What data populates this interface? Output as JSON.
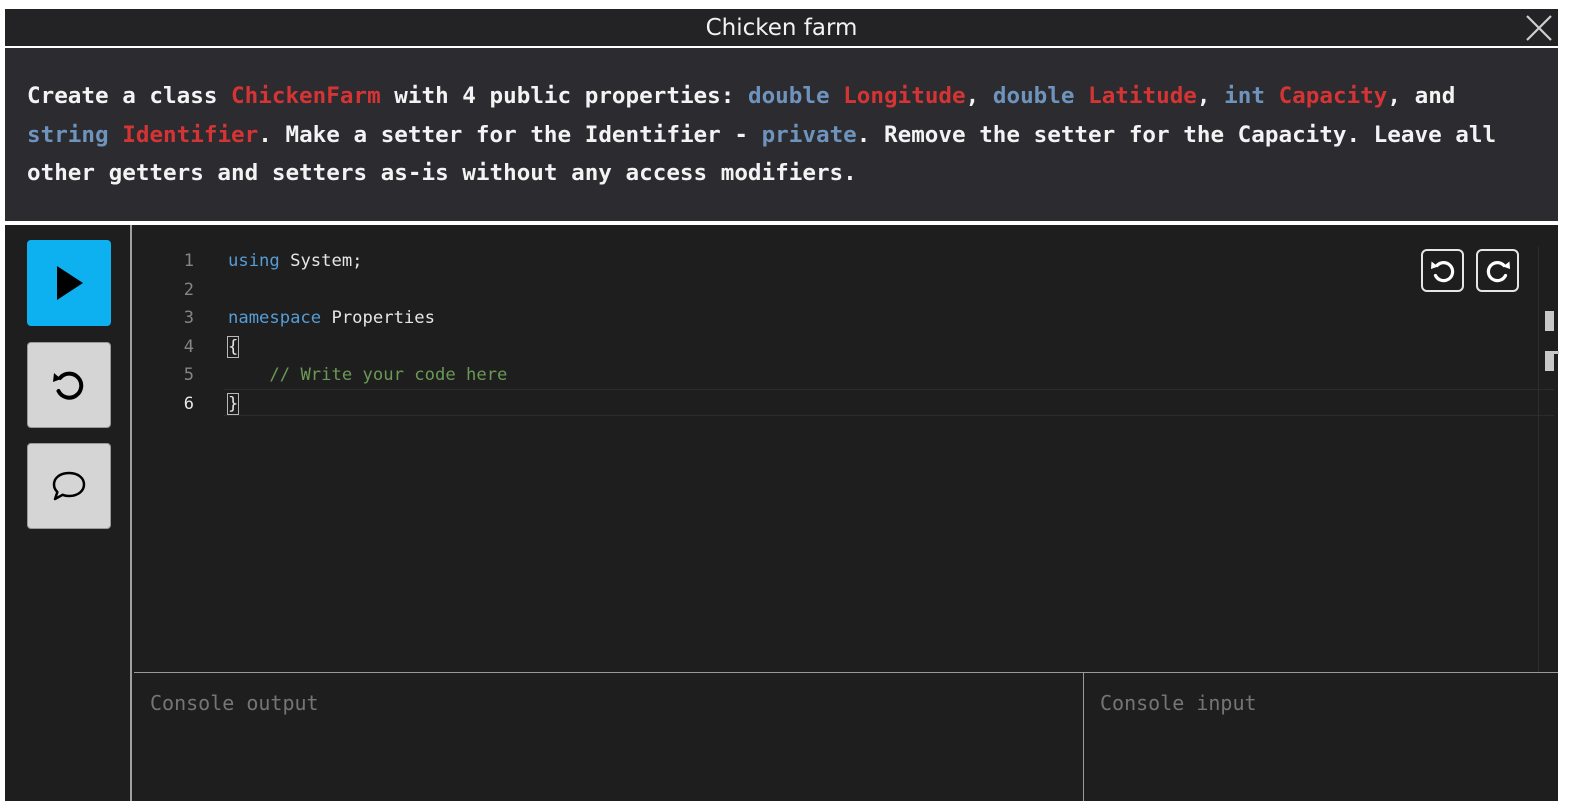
{
  "window": {
    "title": "Chicken farm"
  },
  "task": {
    "segments": [
      {
        "text": "Create a class ",
        "style": "plain"
      },
      {
        "text": "ChickenFarm",
        "style": "id"
      },
      {
        "text": " with 4 public properties: ",
        "style": "plain"
      },
      {
        "text": "double",
        "style": "kw"
      },
      {
        "text": " ",
        "style": "plain"
      },
      {
        "text": "Longitude",
        "style": "id"
      },
      {
        "text": ", ",
        "style": "plain"
      },
      {
        "text": "double",
        "style": "kw"
      },
      {
        "text": " ",
        "style": "plain"
      },
      {
        "text": "Latitude",
        "style": "id"
      },
      {
        "text": ", ",
        "style": "plain"
      },
      {
        "text": "int",
        "style": "kw"
      },
      {
        "text": " ",
        "style": "plain"
      },
      {
        "text": "Capacity",
        "style": "id"
      },
      {
        "text": ", and ",
        "style": "plain"
      },
      {
        "text": "string",
        "style": "kw"
      },
      {
        "text": " ",
        "style": "plain"
      },
      {
        "text": "Identifier",
        "style": "id"
      },
      {
        "text": ". Make a setter for the Identifier - ",
        "style": "plain"
      },
      {
        "text": "private",
        "style": "kw"
      },
      {
        "text": ". Remove the setter for the Capacity. Leave all other getters and setters as-is without any access modifiers.",
        "style": "plain"
      }
    ]
  },
  "editor": {
    "line_numbers": [
      "1",
      "2",
      "3",
      "4",
      "5",
      "6"
    ],
    "active_line": "6",
    "lines": {
      "l1_kw": "using",
      "l1_rest": " System;",
      "l3_kw": "namespace",
      "l3_rest": " Properties",
      "l4": "{",
      "l5_indent": "    ",
      "l5_comment": "// Write your code here",
      "l6": "}"
    }
  },
  "console": {
    "output_placeholder": "Console output",
    "input_placeholder": "Console input"
  },
  "colors": {
    "accent": "#0eb1f0",
    "keyword": "#569cd6",
    "comment": "#6a9955",
    "task_identifier": "#d53434",
    "task_keyword": "#6e94bd"
  },
  "icons": [
    "close-icon",
    "play-icon",
    "reset-icon",
    "chat-icon",
    "undo-icon",
    "redo-icon"
  ]
}
